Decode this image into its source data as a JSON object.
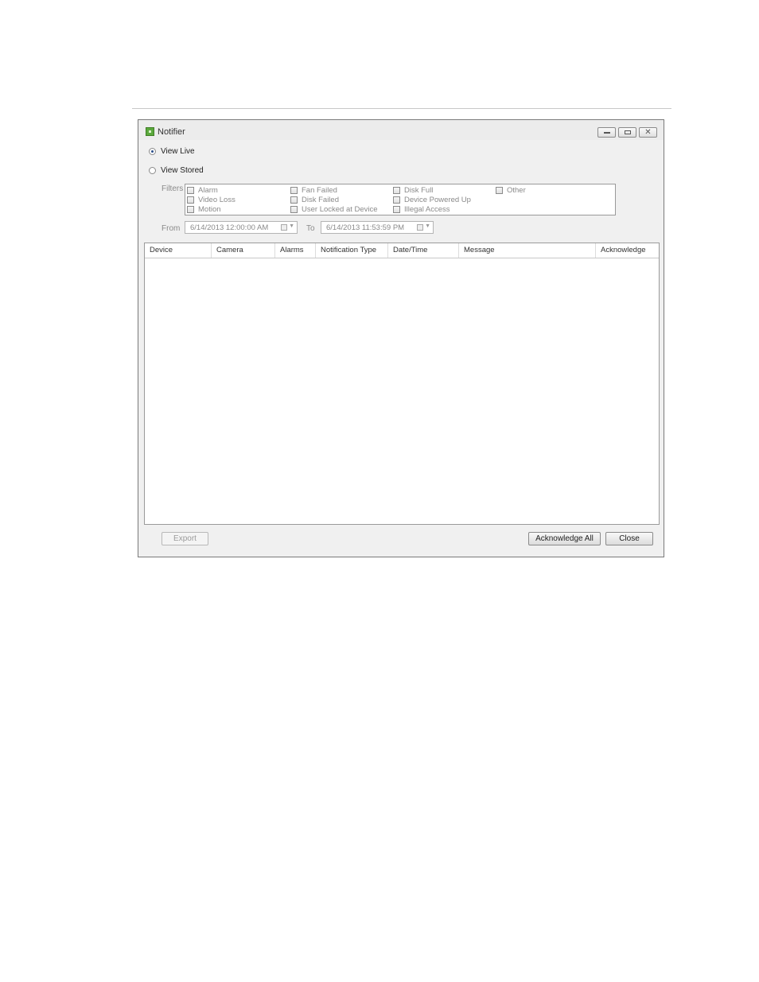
{
  "window": {
    "title": "Notifier",
    "icon": "notifier-app-icon"
  },
  "view_mode": {
    "options": [
      {
        "label": "View Live",
        "selected": true
      },
      {
        "label": "View Stored",
        "selected": false
      }
    ]
  },
  "filters": {
    "label": "Filters",
    "items": [
      {
        "label": "Alarm",
        "checked": false
      },
      {
        "label": "Video Loss",
        "checked": false
      },
      {
        "label": "Motion",
        "checked": false
      },
      {
        "label": "Fan Failed",
        "checked": false
      },
      {
        "label": "Disk Failed",
        "checked": false
      },
      {
        "label": "User Locked at Device",
        "checked": false
      },
      {
        "label": "Disk Full",
        "checked": false
      },
      {
        "label": "Device Powered Up",
        "checked": false
      },
      {
        "label": "Illegal Access",
        "checked": false
      },
      {
        "label": "Other",
        "checked": false
      }
    ]
  },
  "range": {
    "from_label": "From",
    "from_value": "6/14/2013 12:00:00 AM",
    "to_label": "To",
    "to_value": "6/14/2013 11:53:59 PM"
  },
  "table": {
    "columns": [
      "Device",
      "Camera",
      "Alarms",
      "Notification Type",
      "Date/Time",
      "Message",
      "Acknowledge"
    ],
    "rows": []
  },
  "buttons": {
    "export": "Export",
    "acknowledge_all": "Acknowledge All",
    "close": "Close"
  }
}
